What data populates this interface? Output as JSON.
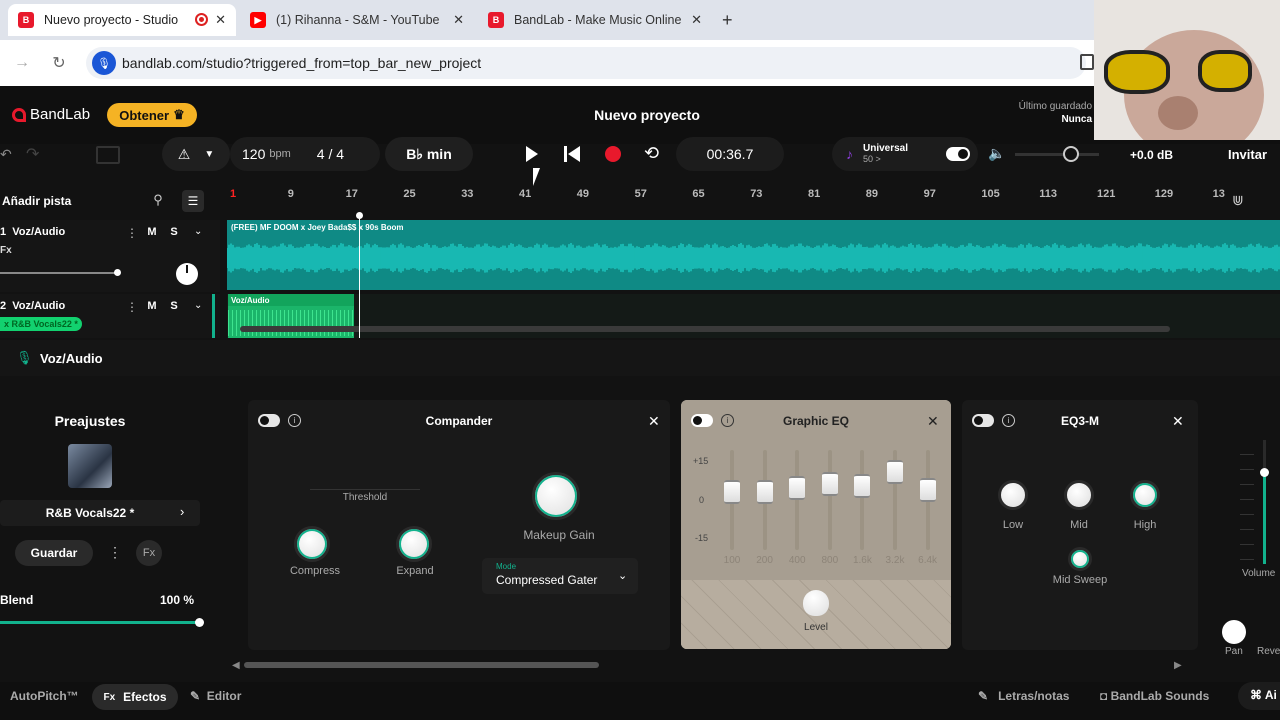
{
  "browser": {
    "tabs": [
      {
        "label": "Nuevo proyecto - Studio",
        "active": true
      },
      {
        "label": "(1) Rihanna - S&M - YouTube",
        "active": false
      },
      {
        "label": "BandLab - Make Music Online",
        "active": false
      }
    ],
    "new_tab_label": "+",
    "url": "bandlab.com/studio?triggered_from=top_bar_new_project"
  },
  "header": {
    "logo": "BandLab",
    "get_button": "Obtener",
    "project_title": "Nuevo proyecto",
    "save_status_line1": "Último guardado",
    "save_status_line2": "Nunca",
    "invite": "Invitar"
  },
  "transport": {
    "tempo_value": "120",
    "tempo_unit": "bpm",
    "time_sig": "4 / 4",
    "key": "B♭ min",
    "time": "00:36.7",
    "universal": "Universal",
    "universal_count": "50 >",
    "volume_db": "+0.0 dB"
  },
  "timeline": {
    "add_track": "Añadir pista",
    "markers": [
      "1",
      "9",
      "17",
      "25",
      "33",
      "41",
      "49",
      "57",
      "65",
      "73",
      "81",
      "89",
      "97",
      "105",
      "113",
      "121",
      "129",
      "13"
    ]
  },
  "tracks": [
    {
      "number": "1",
      "name": "Voz/Audio",
      "fx": "Fx",
      "clip": "(FREE) MF DOOM x Joey Bada$$ x 90s Boom"
    },
    {
      "number": "2",
      "name": "Voz/Audio",
      "preset_badge": "x R&B Vocals22 *",
      "clip": "Voz/Audio"
    }
  ],
  "track_buttons": {
    "mute": "M",
    "solo": "S"
  },
  "effects_header": {
    "track_name": "Voz/Audio"
  },
  "presets": {
    "title": "Preajustes",
    "preset_name": "R&B Vocals22 *",
    "save": "Guardar",
    "blend_label": "Blend",
    "blend_value": "100 %",
    "blend_fraction": 1.0
  },
  "compander": {
    "title": "Compander",
    "threshold": "Threshold",
    "compress": "Compress",
    "expand": "Expand",
    "makeup": "Makeup Gain",
    "mode_label": "Mode",
    "mode_value": "Compressed Gater"
  },
  "graphic_eq": {
    "title": "Graphic EQ",
    "scale": [
      "+15",
      "0",
      "-15"
    ],
    "bands": [
      "100",
      "200",
      "400",
      "800",
      "1.6k",
      "3.2k",
      "6.4k"
    ],
    "level": "Level"
  },
  "eq3m": {
    "title": "EQ3-M",
    "low": "Low",
    "mid": "Mid",
    "high": "High",
    "mid_sweep": "Mid Sweep"
  },
  "right_strip": {
    "volume": "Volume",
    "pan": "Pan",
    "reverb": "Reve"
  },
  "bottom_bar": {
    "autopitch": "AutoPitch™",
    "effects": "Efectos",
    "editor": "Editor",
    "lyrics": "Letras/notas",
    "sounds": "BandLab Sounds",
    "extra": "Ai"
  },
  "colors": {
    "accent": "#12b28d",
    "record": "#e8192c",
    "waveform": "#1cc8c0",
    "badge": "#f5b324"
  }
}
